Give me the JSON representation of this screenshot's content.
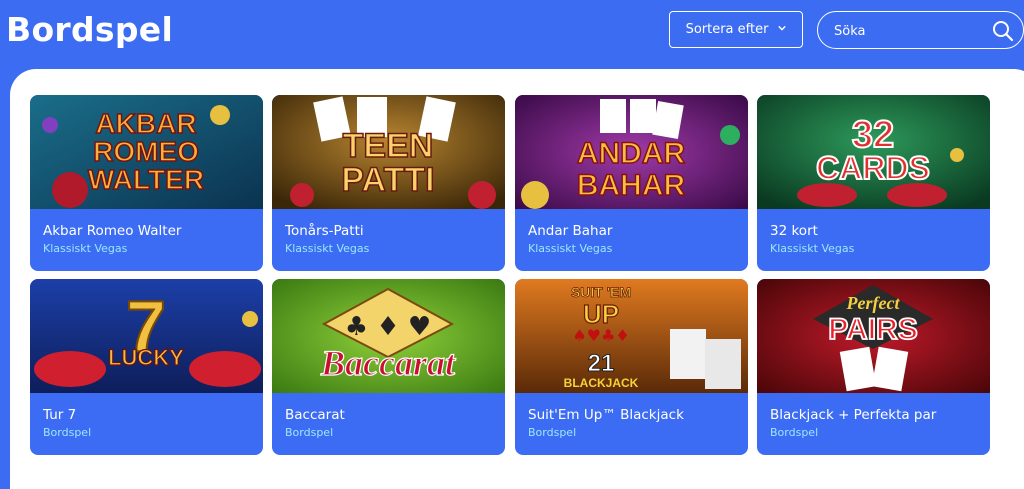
{
  "header": {
    "title": "Bordspel",
    "sort_label": "Sortera efter",
    "search_placeholder": "Söka"
  },
  "games": [
    {
      "name": "Akbar Romeo Walter",
      "category": "Klassiskt Vegas",
      "art_lines": [
        "AKBAR",
        "ROMEO",
        "WALTER"
      ]
    },
    {
      "name": "Tonårs-Patti",
      "category": "Klassiskt Vegas",
      "art_lines": [
        "TEEN",
        "PATTI"
      ]
    },
    {
      "name": "Andar Bahar",
      "category": "Klassiskt Vegas",
      "art_lines": [
        "ANDAR",
        "BAHAR"
      ]
    },
    {
      "name": "32 kort",
      "category": "Klassiskt Vegas",
      "art_lines": [
        "32",
        "CARDS"
      ]
    },
    {
      "name": "Tur 7",
      "category": "Bordspel",
      "art_lines": [
        "7",
        "LUCKY"
      ]
    },
    {
      "name": "Baccarat",
      "category": "Bordspel",
      "art_lines": [
        "Baccarat"
      ]
    },
    {
      "name": "Suit'Em Up™ Blackjack",
      "category": "Bordspel",
      "art_lines": [
        "SUIT 'EM",
        "UP",
        "21",
        "BLACKJACK"
      ]
    },
    {
      "name": "Blackjack + Perfekta par",
      "category": "Bordspel",
      "art_lines": [
        "Perfect",
        "PAIRS"
      ]
    }
  ],
  "colors": {
    "brand_blue": "#3b6cf2",
    "category_text": "#9be7ff"
  }
}
